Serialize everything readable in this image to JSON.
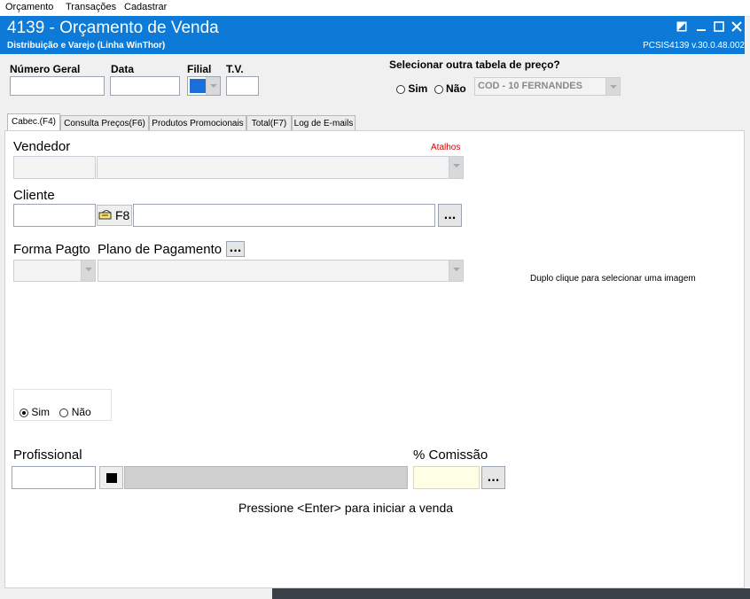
{
  "menu": [
    "Orçamento",
    "Transações",
    "Cadastrar"
  ],
  "window": {
    "title": "4139 - Orçamento de Venda",
    "subtitle": "Distribuição e Varejo (Linha WinThor)",
    "version": "PCSIS4139  v.30.0.48.002"
  },
  "header": {
    "numero_geral_label": "Número Geral",
    "data_label": "Data",
    "filial_label": "Filial",
    "tv_label": "T.V.",
    "price_table_label": "Selecionar outra tabela de preço?",
    "price_yes": "Sim",
    "price_no": "Não",
    "price_table_value": "COD - 10 FERNANDES"
  },
  "tabs": [
    "Cabec.(F4)",
    "Consulta Preços(F6)",
    "Produtos Promocionais",
    "Total(F7)",
    "Log de E-mails"
  ],
  "form": {
    "vendedor_label": "Vendedor",
    "atalhos_link": "Atalhos",
    "cliente_label": "Cliente",
    "f8_label": "F8",
    "ellipsis": "...",
    "forma_pagto_label": "Forma Pagto",
    "plano_pagamento_label": "Plano de Pagamento",
    "image_hint": "Duplo clique para selecionar uma imagem",
    "sim_label": "Sim",
    "nao_label": "Não",
    "profissional_label": "Profissional",
    "comissao_label": "% Comissão",
    "enter_hint": "Pressione <Enter> para iniciar a venda"
  },
  "colors": {
    "titlebar": "#0c7ad6",
    "atalhos": "#d40000",
    "comissao_field": "#ffffe6"
  }
}
